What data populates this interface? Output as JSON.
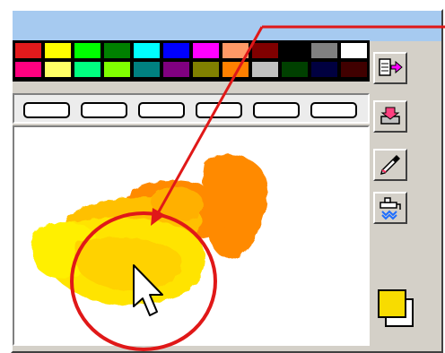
{
  "palette": {
    "top_row": [
      "#e31a1c",
      "#ffff00",
      "#00ff00",
      "#008000",
      "#00ffff",
      "#0000ff",
      "#ff00ff",
      "#ff9966",
      "#800000",
      "#000000",
      "#808080",
      "#ffffff"
    ],
    "bottom_row": [
      "#ff0080",
      "#ffff66",
      "#00ff80",
      "#80ff00",
      "#008080",
      "#800080",
      "#808000",
      "#ff8000",
      "#c0c0c0",
      "#004000",
      "#000040",
      "#400000"
    ]
  },
  "tabs": {
    "count": 6
  },
  "tools": [
    {
      "name": "load-palette-icon",
      "interactable": true
    },
    {
      "name": "paint-bucket-icon",
      "interactable": true
    },
    {
      "name": "eyedropper-icon",
      "interactable": true
    },
    {
      "name": "faucet-icon",
      "interactable": true
    }
  ],
  "colors": {
    "foreground": "#f8dc00",
    "background": "#ffffff",
    "annotation": "#e01818",
    "canvas_strokes": [
      "#ff8c00",
      "#ffc400",
      "#ffe000",
      "#fff200"
    ]
  }
}
